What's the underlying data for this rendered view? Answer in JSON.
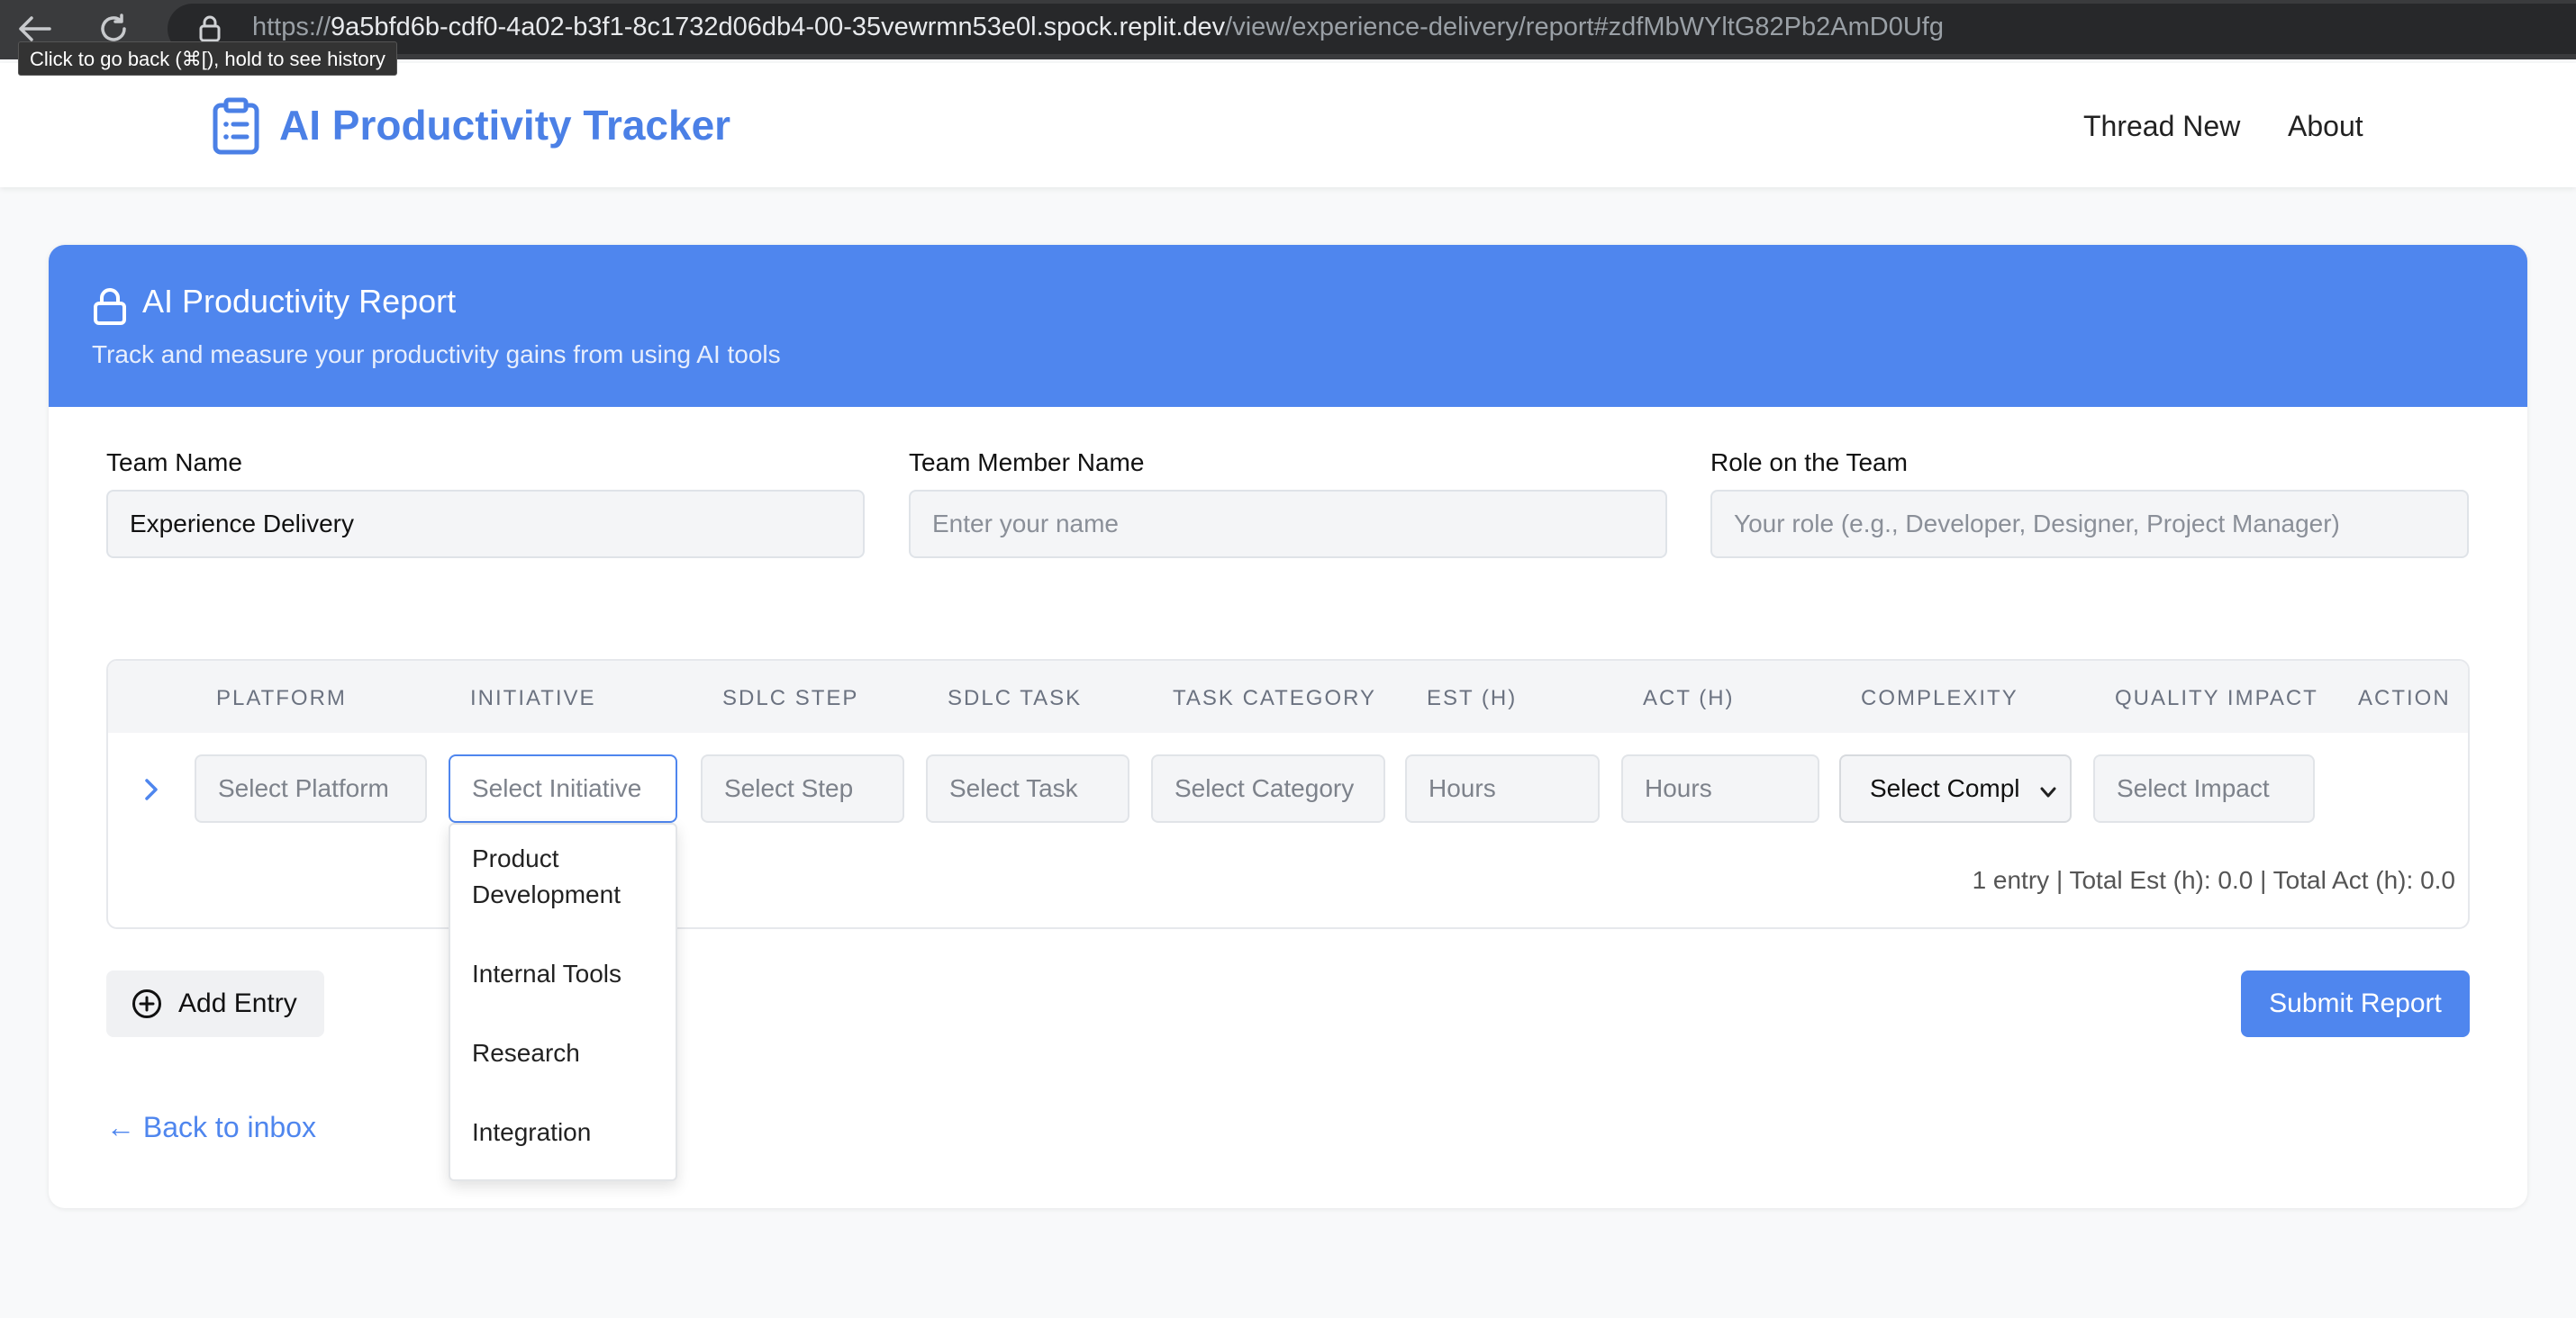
{
  "browser": {
    "url_scheme": "https://",
    "url_host": "9a5bfd6b-cdf0-4a02-b3f1-8c1732d06db4-00-35vewrmn53e0l.spock.replit.dev",
    "url_path": "/view/experience-delivery/report#zdfMbWYltG82Pb2AmD0Ufg",
    "back_tooltip": "Click to go back (⌘[), hold to see history"
  },
  "header": {
    "brand": "AI Productivity Tracker",
    "nav": [
      "Thread New",
      "About"
    ]
  },
  "report": {
    "title": "AI Productivity Report",
    "subtitle": "Track and measure your productivity gains from using AI tools"
  },
  "fields": {
    "team_name": {
      "label": "Team Name",
      "value": "Experience Delivery"
    },
    "member_name": {
      "label": "Team Member Name",
      "placeholder": "Enter your name"
    },
    "role": {
      "label": "Role on the Team",
      "placeholder": "Your role (e.g., Developer, Designer, Project Manager)"
    }
  },
  "table": {
    "columns": [
      "PLATFORM",
      "INITIATIVE",
      "SDLC STEP",
      "SDLC TASK",
      "TASK CATEGORY",
      "EST (H)",
      "ACT (H)",
      "COMPLEXITY",
      "QUALITY IMPACT",
      "ACTION"
    ],
    "row": {
      "platform_placeholder": "Select Platform",
      "initiative_placeholder": "Select Initiative",
      "step_placeholder": "Select Step",
      "task_placeholder": "Select Task",
      "category_placeholder": "Select Category",
      "est_placeholder": "Hours",
      "act_placeholder": "Hours",
      "complexity_value": "Select Compl",
      "impact_placeholder": "Select Impact"
    },
    "summary": "1 entry | Total Est (h): 0.0 | Total Act (h): 0.0"
  },
  "initiative_dropdown": [
    "Product Development",
    "Internal Tools",
    "Research",
    "Integration"
  ],
  "actions": {
    "add_entry": "Add Entry",
    "submit": "Submit Report",
    "back": "← Back to inbox"
  },
  "colors": {
    "accent": "#4f86ee",
    "brand": "#4b80e6"
  }
}
